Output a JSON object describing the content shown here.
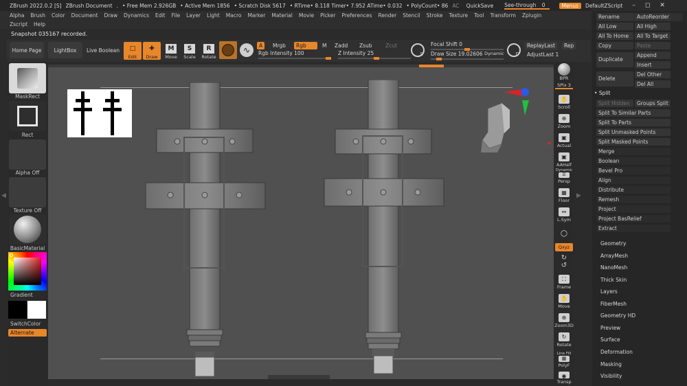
{
  "titlebar": {
    "items": [
      "ZBrush 2022.0.2 [S]",
      "ZBrush Document",
      ".",
      "• Free Mem 2.926GB",
      "• Active Mem 1856",
      "• Scratch Disk 5617",
      "• RTime• 8.118 Timer• 7.952 ATime• 0.032",
      "• PolyCount• 86",
      "AC"
    ],
    "quicksave": "QuickSave",
    "seethrough": "See-through",
    "seethrough_value": "0",
    "menus": "Menus",
    "zscript": "DefaultZScript"
  },
  "menubar": {
    "row1": [
      "Alpha",
      "Brush",
      "Color",
      "Document",
      "Draw",
      "Dynamics",
      "Edit",
      "File",
      "Layer",
      "Light",
      "Macro",
      "Marker",
      "Material",
      "Movie",
      "Picker",
      "Preferences",
      "Render",
      "Stencil",
      "Stroke",
      "Texture",
      "Tool",
      "Transform",
      "Zplugin"
    ],
    "row2": [
      "Zscript",
      "Help"
    ]
  },
  "notice": "Snapshot 035167 recorded.",
  "toolbar": {
    "home_page": "Home Page",
    "lightbox": "LightBox",
    "live_boolean": "Live Boolean",
    "edit": "Edit",
    "draw": "Draw",
    "move": "Move",
    "scale": "Scale",
    "rotate": "Rotate",
    "a": "A",
    "mrgb": "Mrgb",
    "rgb": "Rgb",
    "m": "M",
    "zadd": "Zadd",
    "zsub": "Zsub",
    "zcut": "Zcut",
    "rgb_intensity_label": "Rgb Intensity",
    "rgb_intensity_value": "100",
    "z_intensity_label": "Z Intensity",
    "z_intensity_value": "25",
    "focal_shift_label": "Focal Shift",
    "focal_shift_value": "0",
    "draw_size_label": "Draw Size",
    "draw_size_value": "19.02606",
    "dynamic": "Dynamic",
    "replaylast": "ReplayLast",
    "rep": "Rep",
    "adjustlast": "AdjustLast",
    "adjustlast_value": "1",
    "s": "S",
    "d": "D"
  },
  "leftpal": {
    "maskrect": "MaskRect",
    "rect": "Rect",
    "alpha_off": "Alpha Off",
    "texture_off": "Texture Off",
    "basic_material": "BasicMaterial",
    "gradient": "Gradient",
    "switch_color": "SwitchColor",
    "alternate": "Alternate"
  },
  "rightshelf": {
    "bpr": "BPR",
    "spix_label": "SPix",
    "spix_value": "3",
    "scroll": "Scroll",
    "zoom": "Zoom",
    "actual": "Actual",
    "aahalf": "AAHalf",
    "dynamic": "Dynamic",
    "persp": "Persp",
    "floor": "Floor",
    "lsym": "L.Sym",
    "qxyz": "Qxyz",
    "frame": "Frame",
    "move": "Move",
    "zoom3d": "Zoom3D",
    "rotate": "Rotate",
    "line_fill": "Line Fill",
    "polyf": "PolyF",
    "transp": "Transp"
  },
  "rpanel": {
    "rename": "Rename",
    "autoreorder": "AutoReorder",
    "all_low": "All Low",
    "all_high": "All High",
    "all_to_home": "All To Home",
    "all_to_target": "All To Target",
    "copy": "Copy",
    "paste": "Paste",
    "duplicate": "Duplicate",
    "append": "Append",
    "insert": "Insert",
    "delete": "Delete",
    "del_other": "Del Other",
    "del_all": "Del All",
    "split": "Split",
    "split_hidden": "Split Hidden",
    "groups_split": "Groups Split",
    "split_similar": "Split To Similar Parts",
    "split_parts": "Split To Parts",
    "split_unmasked": "Split Unmasked Points",
    "split_masked": "Split Masked Points",
    "merge": "Merge",
    "boolean": "Boolean",
    "bevel_pro": "Bevel Pro",
    "align": "Align",
    "distribute": "Distribute",
    "remesh": "Remesh",
    "project": "Project",
    "project_basrelief": "Project BasRelief",
    "extract": "Extract",
    "sections": [
      "Geometry",
      "ArrayMesh",
      "NanoMesh",
      "Thick Skin",
      "Layers",
      "FiberMesh",
      "Geometry HD",
      "Preview",
      "Surface",
      "Deformation",
      "Masking",
      "Visibility"
    ]
  },
  "colors": {
    "accent": "#e8862a",
    "panel": "#2b2b2b",
    "canvas": "#505050"
  }
}
